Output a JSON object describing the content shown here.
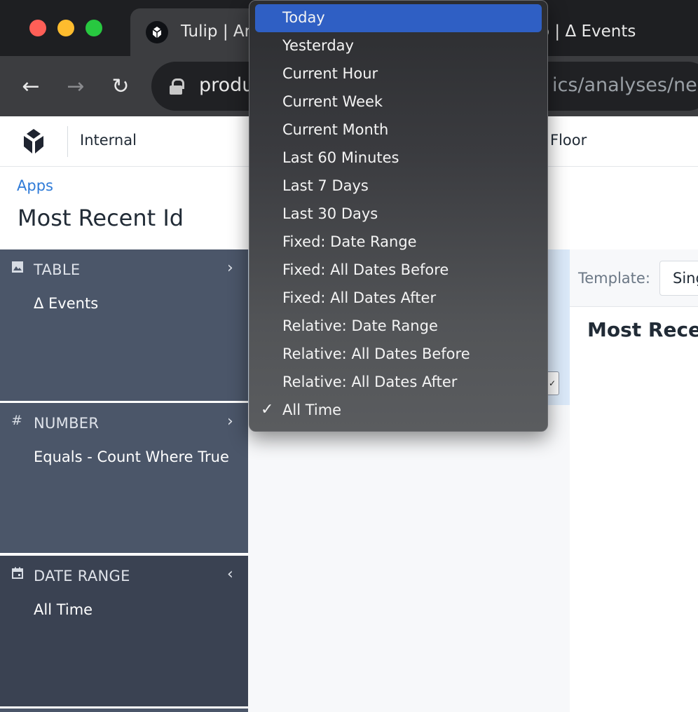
{
  "browser": {
    "active_tab_title": "Tulip | Ar",
    "inactive_tab_title": "o | Δ Events",
    "url_visible_left": "produ",
    "url_visible_right": "ics/analyses/new",
    "nav": {
      "back": "←",
      "forward": "→",
      "reload": "↻"
    }
  },
  "app_header": {
    "workspace": "Internal",
    "floor_label": "Floor"
  },
  "breadcrumb": "Apps",
  "page_title": "Most Recent Id",
  "config": {
    "table": {
      "icon": "image-icon",
      "label": "TABLE",
      "value": "Δ Events",
      "chevron": "›"
    },
    "number": {
      "icon": "hash-icon",
      "label": "NUMBER",
      "value": "Equals - Count Where True",
      "chevron": "›"
    },
    "date_range": {
      "icon": "calendar-icon",
      "label": "DATE RANGE",
      "value": "All Time",
      "chevron": "‹"
    }
  },
  "right_panel": {
    "template_label": "Template:",
    "template_value": "Sing",
    "chart_title": "Most Recen"
  },
  "date_menu": {
    "highlighted_index": 0,
    "checked_index": 14,
    "check_glyph": "✓",
    "items": [
      "Today",
      "Yesterday",
      "Current Hour",
      "Current Week",
      "Current Month",
      "Last 60 Minutes",
      "Last 7 Days",
      "Last 30 Days",
      "Fixed: Date Range",
      "Fixed: All Dates Before",
      "Fixed: All Dates After",
      "Relative: Date Range",
      "Relative: All Dates Before",
      "Relative: All Dates After",
      "All Time"
    ]
  },
  "colors": {
    "highlight": "#2f5fc4",
    "link": "#2f7bd8",
    "panel": "#4b5669",
    "panel_active": "#3a4252"
  }
}
